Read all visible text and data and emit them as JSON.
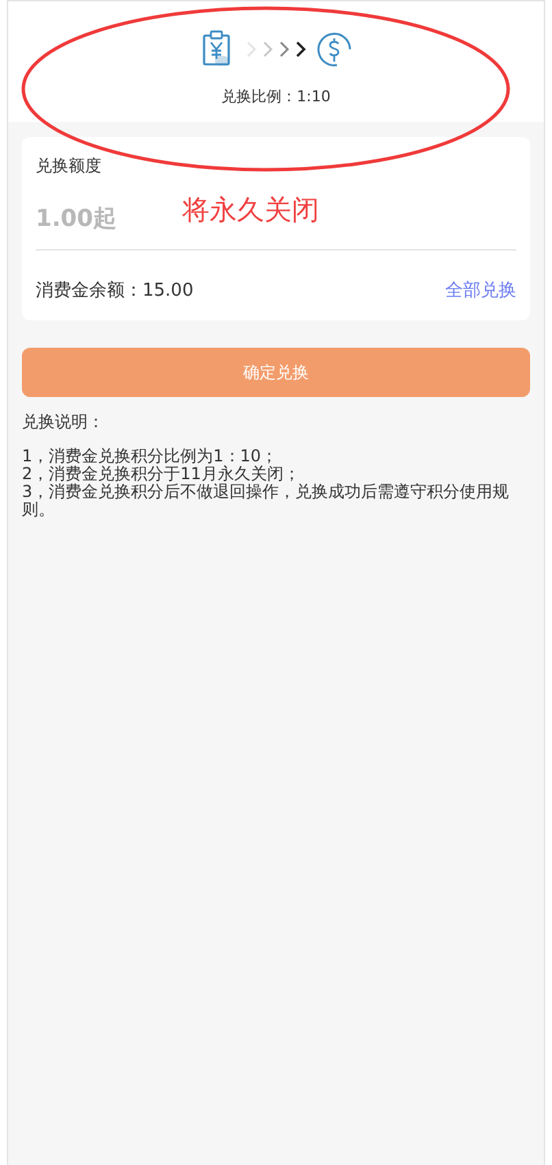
{
  "header": {
    "ratio_text": "兑换比例：1:10"
  },
  "form": {
    "label": "兑换额度",
    "placeholder": "1.00起",
    "balance": "消费金余额：15.00",
    "all_link": "全部兑换"
  },
  "submit_button": "确定兑换",
  "notes": {
    "title": "兑换说明：",
    "items": [
      "1，消费金兑换积分比例为1：10；",
      "2，消费金兑换积分于11月永久关闭；",
      "3，消费金兑换积分后不做退回操作，兑换成功后需遵守积分使用规则。"
    ]
  },
  "annotation": {
    "text": "将永久关闭"
  }
}
